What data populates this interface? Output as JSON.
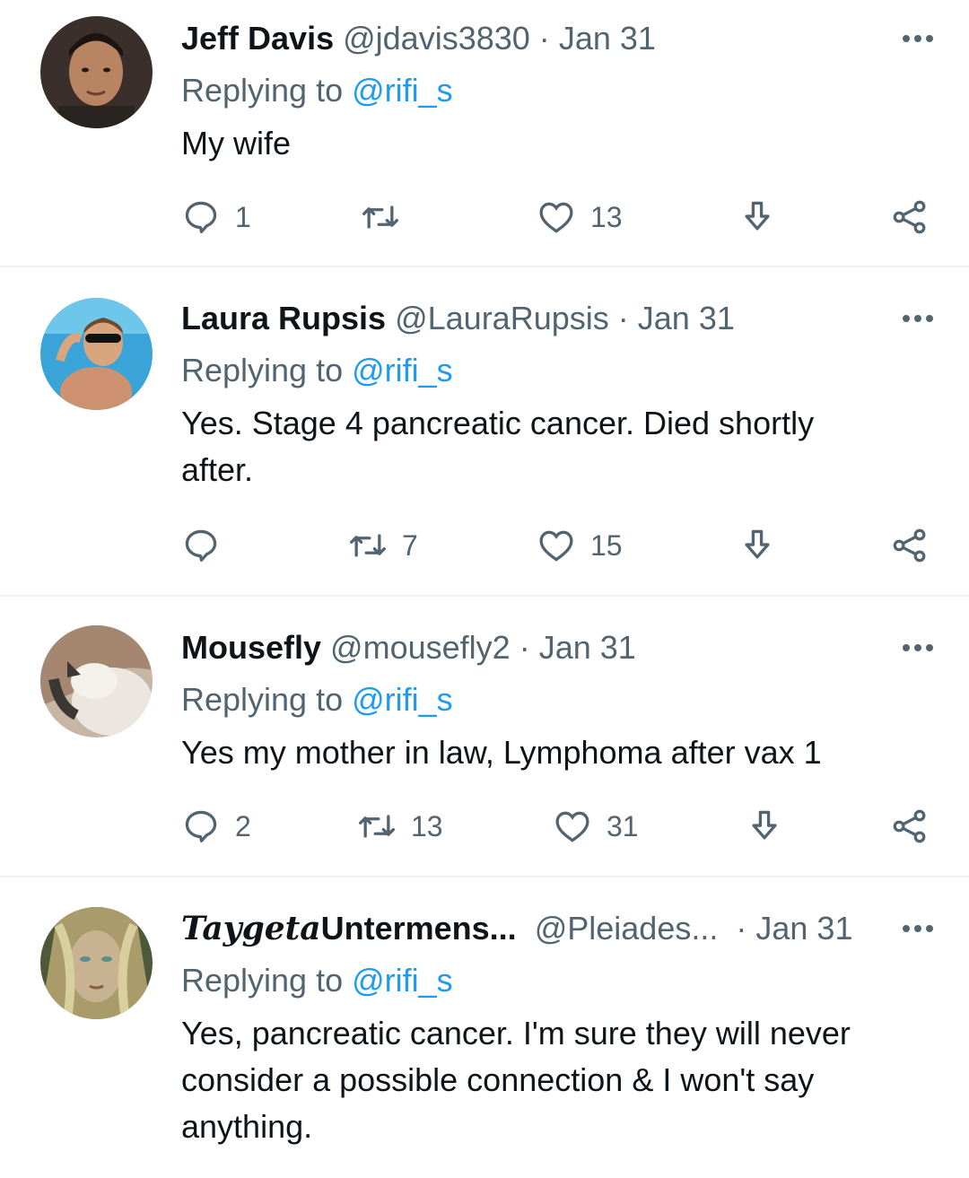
{
  "tweets": [
    {
      "name": "Jeff Davis",
      "handle": "@jdavis3830",
      "dot": "·",
      "date": "Jan 31",
      "replying_prefix": "Replying to ",
      "replying_to": "@rifi_s",
      "text_lines": [
        "My wife"
      ],
      "reply_count": "1",
      "retweet_count": "",
      "like_count": "13",
      "avatar": "man-portrait"
    },
    {
      "name": "Laura Rupsis",
      "handle": "@LauraRupsis",
      "dot": "·",
      "date": "Jan 31",
      "replying_prefix": "Replying to ",
      "replying_to": "@rifi_s",
      "text_lines": [
        "Yes. Stage 4 pancreatic cancer. Died shortly",
        "after."
      ],
      "reply_count": "",
      "retweet_count": "7",
      "like_count": "15",
      "avatar": "woman-pool"
    },
    {
      "name": "Mousefly",
      "handle": "@mousefly2",
      "dot": "·",
      "date": "Jan 31",
      "replying_prefix": "Replying to ",
      "replying_to": "@rifi_s",
      "text_lines": [
        "Yes my mother in law, Lymphoma after vax 1"
      ],
      "reply_count": "2",
      "retweet_count": "13",
      "like_count": "31",
      "avatar": "cat"
    },
    {
      "name_fancy": "Taygeta",
      "name": "Untermens...",
      "handle": "@Pleiades...",
      "dot": "·",
      "date": "Jan 31",
      "replying_prefix": "Replying to ",
      "replying_to": "@rifi_s",
      "text_lines": [
        "Yes, pancreatic cancer. I'm sure they will never",
        "consider a possible connection & I won't say",
        "anything."
      ],
      "avatar": "fantasy-woman"
    }
  ],
  "icons": {
    "more": "more-dots-icon",
    "reply": "reply-bubble-icon",
    "retweet": "retweet-icon",
    "like": "heart-icon",
    "download": "download-arrow-icon",
    "share": "share-icon"
  },
  "colors": {
    "text": "#0f1419",
    "secondary": "#536471",
    "link": "#1d9bf0",
    "divider": "#eff3f4"
  }
}
